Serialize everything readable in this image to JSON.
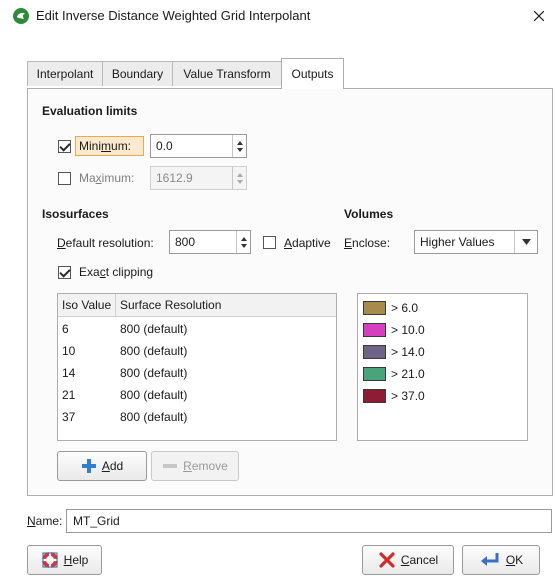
{
  "window": {
    "title": "Edit Inverse Distance Weighted Grid Interpolant",
    "icon": "leapfrog-app-icon",
    "close_icon": "close-icon"
  },
  "tabs": [
    {
      "label": "Interpolant",
      "active": false
    },
    {
      "label": "Boundary",
      "active": false
    },
    {
      "label": "Value Transform",
      "active": false
    },
    {
      "label": "Outputs",
      "active": true
    }
  ],
  "evaluation_limits": {
    "title": "Evaluation limits",
    "minimum": {
      "label_pre": "Mini",
      "label_u": "m",
      "label_post": "um:",
      "checked": true,
      "value": "0.0"
    },
    "maximum": {
      "label_pre": "Ma",
      "label_u": "x",
      "label_post": "imum:",
      "checked": false,
      "value": "1612.9"
    }
  },
  "isosurfaces": {
    "title": "Isosurfaces",
    "default_resolution_label_u": "D",
    "default_resolution_label_rest": "efault resolution:",
    "default_resolution_value": "800",
    "adaptive_label_u": "A",
    "adaptive_label_rest": "daptive",
    "adaptive_checked": false,
    "exact_clipping_label_pre": "Exa",
    "exact_clipping_label_u": "c",
    "exact_clipping_label_post": "t clipping",
    "exact_clipping_checked": true,
    "columns": [
      "Iso Value",
      "Surface Resolution"
    ],
    "rows": [
      {
        "iso": "6",
        "resolution": "800 (default)"
      },
      {
        "iso": "10",
        "resolution": "800 (default)"
      },
      {
        "iso": "14",
        "resolution": "800 (default)"
      },
      {
        "iso": "21",
        "resolution": "800 (default)"
      },
      {
        "iso": "37",
        "resolution": "800 (default)"
      }
    ],
    "add_label_u": "A",
    "add_label_rest": "dd",
    "remove_label_u": "R",
    "remove_label_rest": "emove"
  },
  "volumes": {
    "title": "Volumes",
    "enclose_label_u": "E",
    "enclose_label_rest": "nclose:",
    "enclose_value": "Higher Values",
    "items": [
      {
        "label": "> 6.0",
        "color": "#a68a4e"
      },
      {
        "label": "> 10.0",
        "color": "#d63fbf"
      },
      {
        "label": "> 14.0",
        "color": "#6f6388"
      },
      {
        "label": "> 21.0",
        "color": "#4aa47b"
      },
      {
        "label": "> 37.0",
        "color": "#8e1c33"
      }
    ]
  },
  "name": {
    "label_u": "N",
    "label_rest": "ame:",
    "value": "MT_Grid"
  },
  "footer": {
    "help_label_u": "H",
    "help_label_rest": "elp",
    "cancel_label_u": "C",
    "cancel_label_rest": "ancel",
    "ok_label_u": "O",
    "ok_label_rest": "K"
  }
}
